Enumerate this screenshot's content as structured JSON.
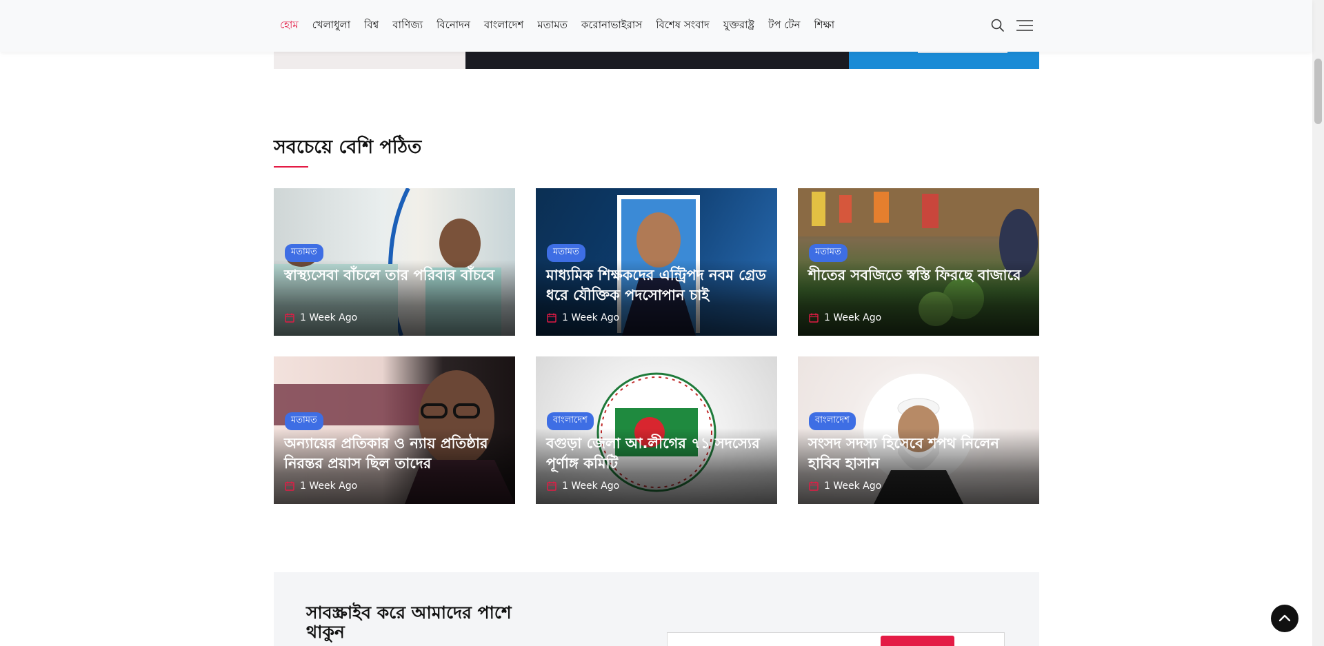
{
  "nav": {
    "items": [
      "হোম",
      "খেলাধুলা",
      "বিশ্ব",
      "বাণিজ্য",
      "বিনোদন",
      "বাংলাদেশ",
      "মতামত",
      "করোনাভাইরাস",
      "বিশেষ সংবাদ",
      "যুক্তরাষ্ট্র",
      "টপ টেন",
      "শিক্ষা"
    ],
    "active_index": 0,
    "accent": "#e41b45",
    "search_icon": "search-icon",
    "menu_icon": "hamburger-icon"
  },
  "section": {
    "title": "সবচেয়ে বেশি পঠিত"
  },
  "cards": [
    {
      "category": "মতামত",
      "title": "স্বাস্থ্যসেবা বাঁচলে তার পরিবার বাঁচবে",
      "date": "1 Week Ago"
    },
    {
      "category": "মতামত",
      "title": "মাধ্যমিক শিক্ষকদের এন্ট্রিপদ নবম গ্রেড ধরে যৌক্তিক পদসোপান চাই",
      "date": "1 Week Ago"
    },
    {
      "category": "মতামত",
      "title": "শীতের সবজিতে স্বস্তি ফিরছে বাজারে",
      "date": "1 Week Ago"
    },
    {
      "category": "মতামত",
      "title": "অন্যায়ের প্রতিকার ও ন্যায় প্রতিষ্ঠার নিরন্তর প্রয়াস ছিল তাদের",
      "date": "1 Week Ago"
    },
    {
      "category": "বাংলাদেশ",
      "title": "বগুড়া জেলা আ.লীগের ৭১ সদস্যের পূর্ণাঙ্গ কমিটি",
      "date": "1 Week Ago"
    },
    {
      "category": "বাংলাদেশ",
      "title": "সংসদ সদস্য হিসেবে শপথ নিলেন হাবিব হাসান",
      "date": "1 Week Ago"
    }
  ],
  "subscribe": {
    "title": "সাবস্ক্রাইব করে আমাদের পাশে থাকুন"
  },
  "colors": {
    "badge": "#3e6ee4",
    "accent": "#e41b45"
  }
}
